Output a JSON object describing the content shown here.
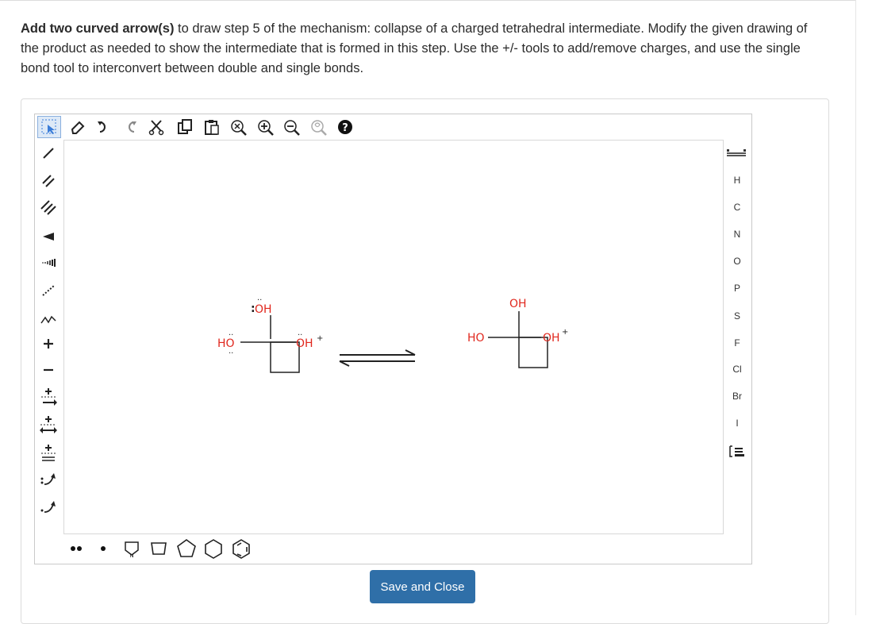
{
  "question": {
    "part1": "Add two curved arrow(s)",
    "part2": " to draw step 5 of the mechanism: collapse of a charged tetrahedral intermediate. Modify the given drawing of the product as needed to show the intermediate that is formed in this step. Use the +/- tools to add/remove charges, and use the single bond tool to interconvert between double and single bonds."
  },
  "left_toolbar": [
    "selection-tool",
    "single-bond-tool",
    "double-bond-tool",
    "triple-bond-tool",
    "wedge-bond-tool",
    "hash-bond-tool",
    "wavy-bond-tool",
    "chain-tool",
    "positive-charge-tool",
    "negative-charge-tool",
    "reaction-arrow-tool",
    "resonance-arrow-tool",
    "equilibrium-arrow-tool",
    "curved-arrow-pair-tool",
    "curved-arrow-single-tool"
  ],
  "top_toolbar": [
    "eraser",
    "undo",
    "redo",
    "cut",
    "copy",
    "paste",
    "zoom-fit",
    "zoom-in",
    "zoom-out",
    "clean",
    "help"
  ],
  "atoms": [
    "H",
    "C",
    "N",
    "O",
    "P",
    "S",
    "F",
    "Cl",
    "Br",
    "I"
  ],
  "molecule_left": {
    "oh_top": "OH",
    "ho_left": "HO",
    "oh_right": "OH",
    "charge": "+"
  },
  "molecule_right": {
    "oh_top": "OH",
    "ho_left": "HO",
    "oh_right": "OH",
    "charge": "+"
  },
  "save_label": "Save and Close",
  "colors": {
    "oxygen": "#e0271d",
    "button": "#2f6fa8",
    "select": "#3b7dd8"
  }
}
